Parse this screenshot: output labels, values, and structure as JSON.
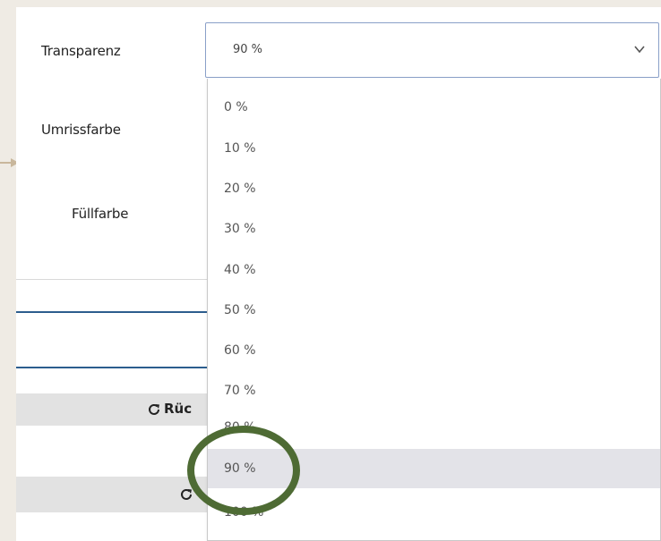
{
  "form": {
    "transparency_label": "Transparenz",
    "outline_color_label": "Umrissfarbe",
    "fill_color_label": "Füllfarbe"
  },
  "select": {
    "value": "90 %",
    "options": [
      "0 %",
      "10 %",
      "20 %",
      "30 %",
      "40 %",
      "50 %",
      "60 %",
      "70 %",
      "80 %",
      "90 %",
      "100 %"
    ],
    "selected_index": 9
  },
  "buttons": {
    "reset_label_partial": "Rüc"
  },
  "colors": {
    "highlight_ring": "#4e6b34",
    "selected_option_bg": "#e3e3e8",
    "accent_line": "#2c5d8e",
    "arrow": "#c9b79c"
  }
}
